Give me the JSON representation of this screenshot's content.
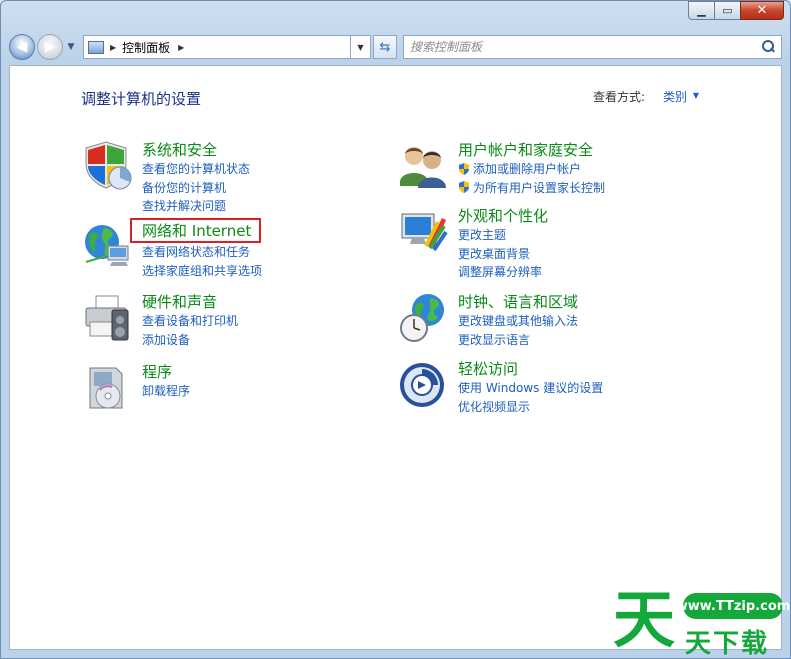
{
  "address": {
    "crumb": "控制面板"
  },
  "search": {
    "placeholder": "搜索控制面板"
  },
  "main": {
    "title": "调整计算机的设置",
    "view_by_label": "查看方式:",
    "view_by_value": "类别"
  },
  "categories": {
    "system": {
      "heading": "系统和安全",
      "links": [
        "查看您的计算机状态",
        "备份您的计算机",
        "查找并解决问题"
      ]
    },
    "network": {
      "heading": "网络和 Internet",
      "links": [
        "查看网络状态和任务",
        "选择家庭组和共享选项"
      ]
    },
    "hardware": {
      "heading": "硬件和声音",
      "links": [
        "查看设备和打印机",
        "添加设备"
      ]
    },
    "programs": {
      "heading": "程序",
      "links": [
        "卸载程序"
      ]
    },
    "users": {
      "heading": "用户帐户和家庭安全",
      "links": [
        "添加或删除用户帐户",
        "为所有用户设置家长控制"
      ]
    },
    "appearance": {
      "heading": "外观和个性化",
      "links": [
        "更改主题",
        "更改桌面背景",
        "调整屏幕分辨率"
      ]
    },
    "clock": {
      "heading": "时钟、语言和区域",
      "links": [
        "更改键盘或其他输入法",
        "更改显示语言"
      ]
    },
    "ease": {
      "heading": "轻松访问",
      "links": [
        "使用 Windows 建议的设置",
        "优化视频显示"
      ]
    }
  },
  "watermark": {
    "big": "天",
    "url": "www.TTzip.com",
    "small": "天下载"
  },
  "colors": {
    "heading": "#0a8a17",
    "link": "#1e5fbf",
    "highlight": "#e02020"
  }
}
